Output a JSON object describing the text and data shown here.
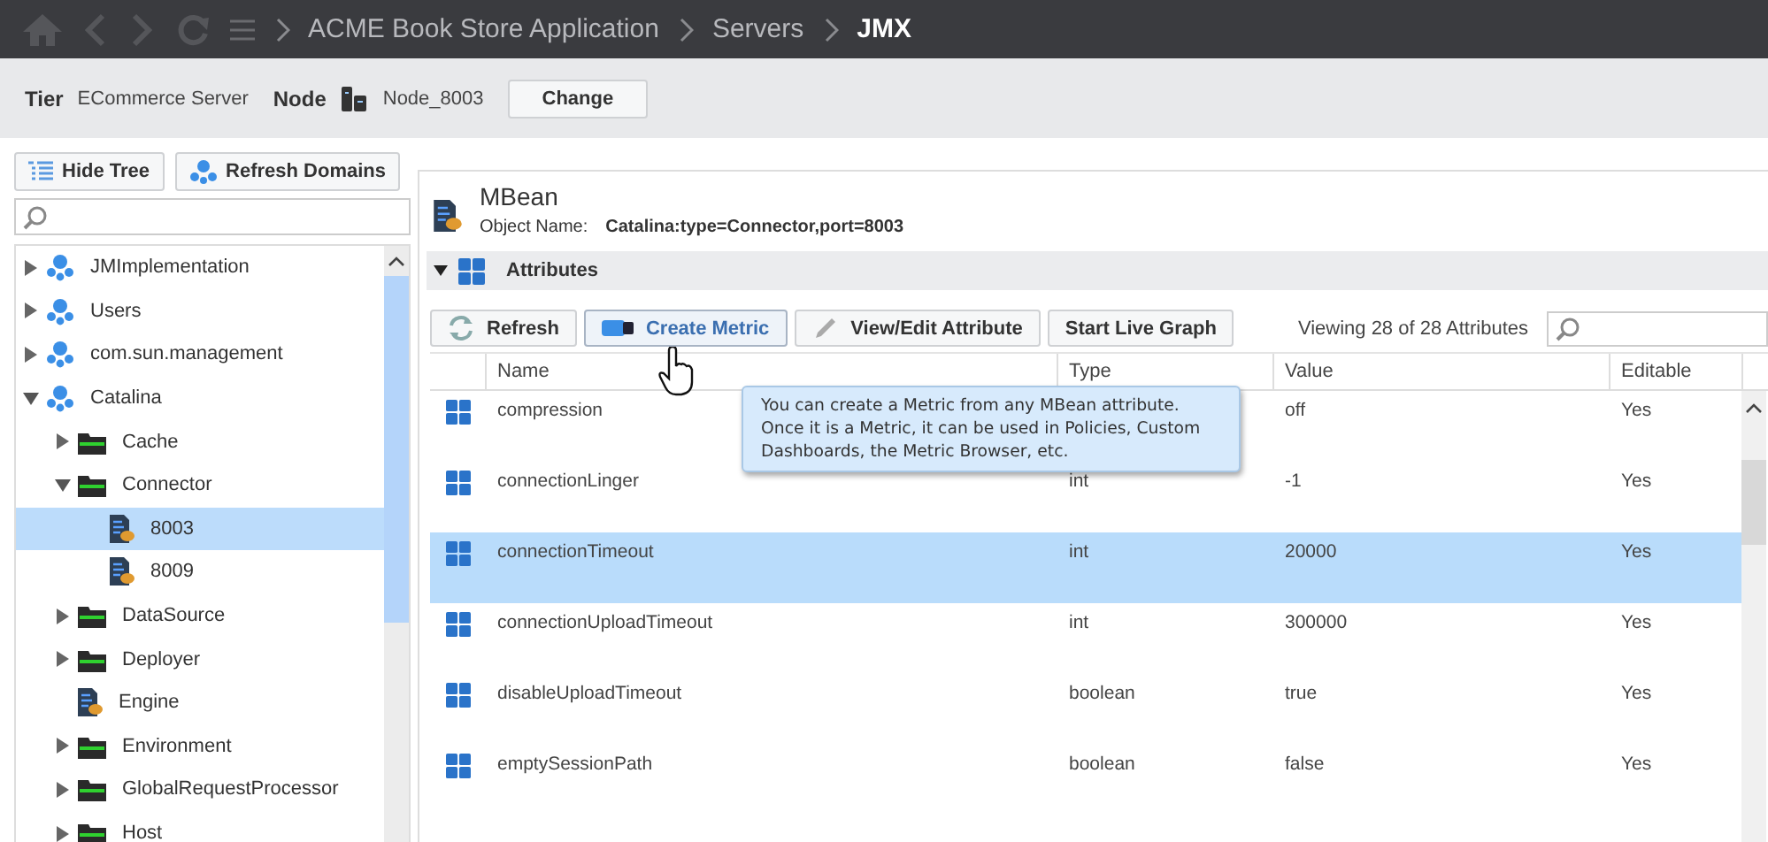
{
  "nav": {
    "breadcrumb": [
      "ACME Book Store Application",
      "Servers",
      "JMX"
    ]
  },
  "context": {
    "tier_label": "Tier",
    "tier": "ECommerce Server",
    "node_label": "Node",
    "node": "Node_8003",
    "change_button": "Change"
  },
  "tree_toolbar": [
    "Hide Tree",
    "Refresh Domains"
  ],
  "tree": [
    {
      "label": "JMImplementation",
      "kind": "domain",
      "expanded": false,
      "selected": false
    },
    {
      "label": "Users",
      "kind": "domain",
      "expanded": false,
      "selected": false
    },
    {
      "label": "com.sun.management",
      "kind": "domain",
      "expanded": false,
      "selected": false
    },
    {
      "label": "Catalina",
      "kind": "domain",
      "expanded": true,
      "selected": false,
      "children": [
        {
          "label": "Cache",
          "kind": "folder",
          "expanded": false,
          "selected": false
        },
        {
          "label": "Connector",
          "kind": "folder",
          "expanded": true,
          "selected": false,
          "children": [
            {
              "label": "8003",
              "kind": "mbean",
              "selected": true
            },
            {
              "label": "8009",
              "kind": "mbean",
              "selected": false
            }
          ]
        },
        {
          "label": "DataSource",
          "kind": "folder",
          "expanded": false,
          "selected": false
        },
        {
          "label": "Deployer",
          "kind": "folder",
          "expanded": false,
          "selected": false
        },
        {
          "label": "Engine",
          "kind": "mbean",
          "selected": false
        },
        {
          "label": "Environment",
          "kind": "folder",
          "expanded": false,
          "selected": false
        },
        {
          "label": "GlobalRequestProcessor",
          "kind": "folder",
          "expanded": false,
          "selected": false
        },
        {
          "label": "Host",
          "kind": "folder",
          "expanded": false,
          "selected": false
        }
      ]
    }
  ],
  "mbean": {
    "title": "MBean",
    "object_name_label": "Object Name:",
    "object_name": "Catalina:type=Connector,port=8003"
  },
  "attributes": {
    "title": "Attributes",
    "expanded": true,
    "buttons": [
      {
        "label": "Refresh",
        "kind": "refresh"
      },
      {
        "label": "Create Metric",
        "kind": "metric"
      },
      {
        "label": "View/Edit Attribute",
        "kind": "edit"
      },
      {
        "label": "Start Live Graph",
        "kind": "plain"
      }
    ],
    "count": "Viewing 28 of 28 Attributes",
    "columns": [
      "Name",
      "Type",
      "Value",
      "Editable"
    ],
    "rows": [
      {
        "name": "compression",
        "type": "",
        "value": "off",
        "editable": "Yes",
        "selected": false
      },
      {
        "name": "connectionLinger",
        "type": "int",
        "value": "-1",
        "editable": "Yes",
        "selected": false
      },
      {
        "name": "connectionTimeout",
        "type": "int",
        "value": "20000",
        "editable": "Yes",
        "selected": true
      },
      {
        "name": "connectionUploadTimeout",
        "type": "int",
        "value": "300000",
        "editable": "Yes",
        "selected": false
      },
      {
        "name": "disableUploadTimeout",
        "type": "boolean",
        "value": "true",
        "editable": "Yes",
        "selected": false
      },
      {
        "name": "emptySessionPath",
        "type": "boolean",
        "value": "false",
        "editable": "Yes",
        "selected": false
      }
    ]
  },
  "tooltip": "You can create a Metric from any MBean attribute.  Once it is a Metric, it can be used in Policies, Custom Dashboards, the Metric Browser, etc."
}
